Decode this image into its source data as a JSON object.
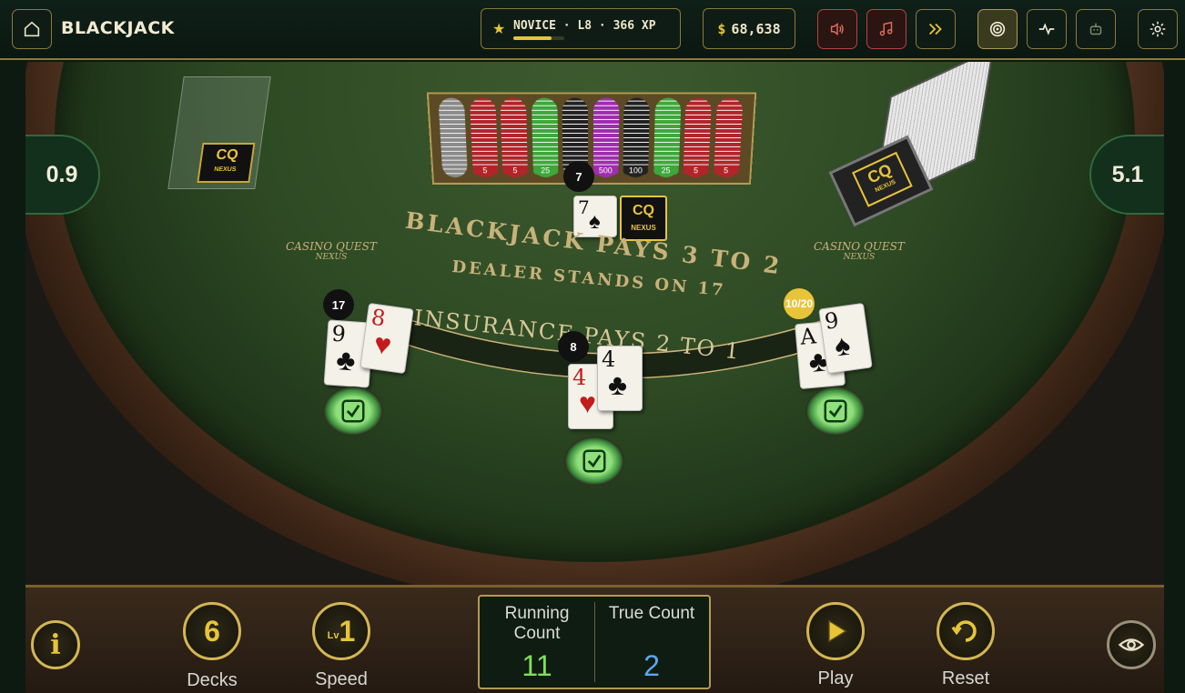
{
  "topbar": {
    "title": "BLACKJACK",
    "rank": "NOVICE · L8 · 366 XP",
    "xp_progress": 0.75,
    "money_symbol": "$",
    "money": "68,638",
    "icons": [
      "home-icon",
      "sound-icon",
      "music-icon",
      "fast-forward-icon",
      "target-icon",
      "pulse-icon",
      "robot-icon",
      "settings-icon"
    ]
  },
  "table": {
    "count_left": "0.9",
    "count_right": "5.1",
    "felt_line1": "BLACKJACK PAYS 3 TO 2",
    "felt_line2": "DEALER STANDS ON 17",
    "insurance": "INSURANCE PAYS 2 TO 1",
    "logo_left": "CASINO QUEST",
    "logo_left_sub": "NEXUS",
    "logo_right": "CASINO QUEST",
    "logo_right_sub": "NEXUS",
    "brand": "CQ",
    "brand_sub": "NEXUS",
    "chip_labels": [
      "5",
      "5",
      "25",
      "",
      "500",
      "100",
      "25",
      "5",
      "5"
    ],
    "dealer": {
      "total": "7",
      "cards": [
        {
          "rank": "7",
          "suit": "♠",
          "color": "black"
        }
      ]
    },
    "hands": [
      {
        "total": "17",
        "cards": [
          {
            "rank": "9",
            "suit": "♣",
            "color": "black"
          },
          {
            "rank": "8",
            "suit": "♥",
            "color": "red"
          }
        ]
      },
      {
        "total": "8",
        "cards": [
          {
            "rank": "4",
            "suit": "♥",
            "color": "red"
          },
          {
            "rank": "4",
            "suit": "♣",
            "color": "black"
          }
        ]
      },
      {
        "total": "10/20",
        "cards": [
          {
            "rank": "A",
            "suit": "♣",
            "color": "black"
          },
          {
            "rank": "9",
            "suit": "♠",
            "color": "black"
          }
        ]
      }
    ]
  },
  "controls": {
    "info_symbol": "i",
    "decks_value": "6",
    "decks_label": "Decks",
    "speed_prefix": "Lv",
    "speed_value": "1",
    "speed_label": "Speed",
    "running_count_label": "Running Count",
    "running_count_value": "11",
    "true_count_label": "True Count",
    "true_count_value": "2",
    "play_label": "Play",
    "reset_label": "Reset",
    "colors": {
      "running": "#7ee05a",
      "true": "#5aa8f0",
      "gold": "#e8c43a"
    }
  }
}
